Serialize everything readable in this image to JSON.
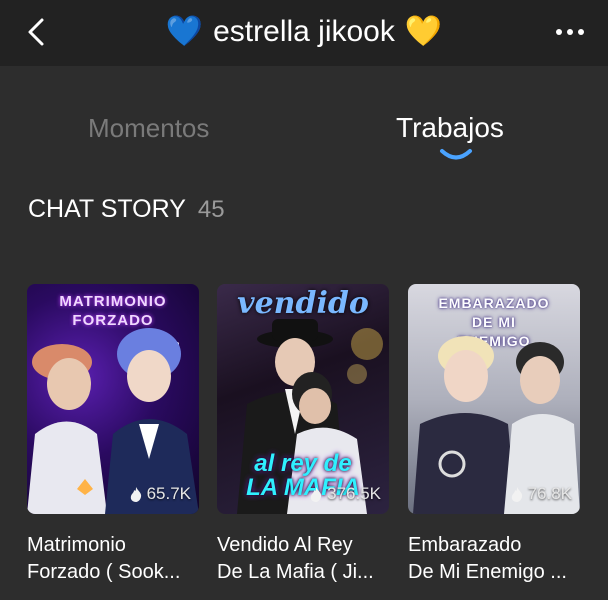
{
  "header": {
    "title": "estrella jikook",
    "left_emoji": "💙",
    "right_emoji": "💛"
  },
  "tabs": [
    {
      "label": "Momentos",
      "active": false
    },
    {
      "label": "Trabajos",
      "active": true
    }
  ],
  "section": {
    "title": "CHAT STORY",
    "count": "45"
  },
  "stories": [
    {
      "cover_text": [
        "MATRIMONIO",
        "FORZADO"
      ],
      "views": "65.7K",
      "caption": [
        "Matrimonio",
        "Forzado ( Sook..."
      ]
    },
    {
      "cover_text": [
        "vendido",
        "al rey de",
        "LA MAFIA"
      ],
      "views": "376.5K",
      "caption": [
        "Vendido Al Rey",
        "De La Mafia ( Ji..."
      ]
    },
    {
      "cover_text": [
        "EMBARAZADO",
        "DE MI",
        "ENEMIGO"
      ],
      "views": "76.8K",
      "caption": [
        "Embarazado",
        "De Mi Enemigo ..."
      ]
    }
  ],
  "colors": {
    "background": "#2d2d2d",
    "header": "#222222",
    "accent": "#4aa3ff",
    "inactive_tab": "#7a7a7a"
  }
}
